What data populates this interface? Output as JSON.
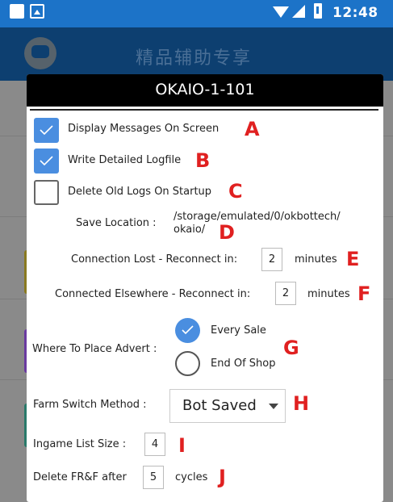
{
  "status_bar": {
    "time": "12:48"
  },
  "app": {
    "title": "精品辅助专享"
  },
  "dialog": {
    "title": "OKAIO-1-101",
    "options": {
      "display_messages": {
        "label": "Display Messages On Screen",
        "checked": true,
        "marker": "A"
      },
      "write_logfile": {
        "label": "Write Detailed Logfile",
        "checked": true,
        "marker": "B"
      },
      "delete_logs": {
        "label": "Delete Old Logs On Startup",
        "checked": false,
        "marker": "C"
      }
    },
    "save_location": {
      "label": "Save Location :",
      "path_line1": "/storage/emulated/0/okbottech/",
      "path_line2": "okaio/",
      "marker": "D"
    },
    "connection_lost": {
      "label": "Connection Lost - Reconnect in:",
      "value": "2",
      "unit": "minutes",
      "marker": "E"
    },
    "connected_elsewhere": {
      "label": "Connected Elsewhere - Reconnect in:",
      "value": "2",
      "unit": "minutes",
      "marker": "F"
    },
    "advert": {
      "label": "Where To Place Advert :",
      "options": [
        {
          "label": "Every Sale",
          "selected": true
        },
        {
          "label": "End Of Shop",
          "selected": false
        }
      ],
      "marker": "G"
    },
    "farm_switch": {
      "label": "Farm Switch Method :",
      "value": "Bot Saved",
      "marker": "H"
    },
    "ingame_list": {
      "label": "Ingame List Size :",
      "value": "4",
      "marker": "I"
    },
    "delete_frf": {
      "label": "Delete FR&F after",
      "value": "5",
      "unit": "cycles",
      "marker": "J"
    }
  },
  "colors": {
    "accent": "#4a8ee0",
    "marker": "#e02020",
    "status_bar": "#1c73c8"
  },
  "icons": [
    "notification-square-icon",
    "photo-notification-icon",
    "wifi-icon",
    "signal-icon",
    "battery-icon",
    "app-logo-icon",
    "checkmark-icon",
    "dropdown-arrow-icon"
  ]
}
